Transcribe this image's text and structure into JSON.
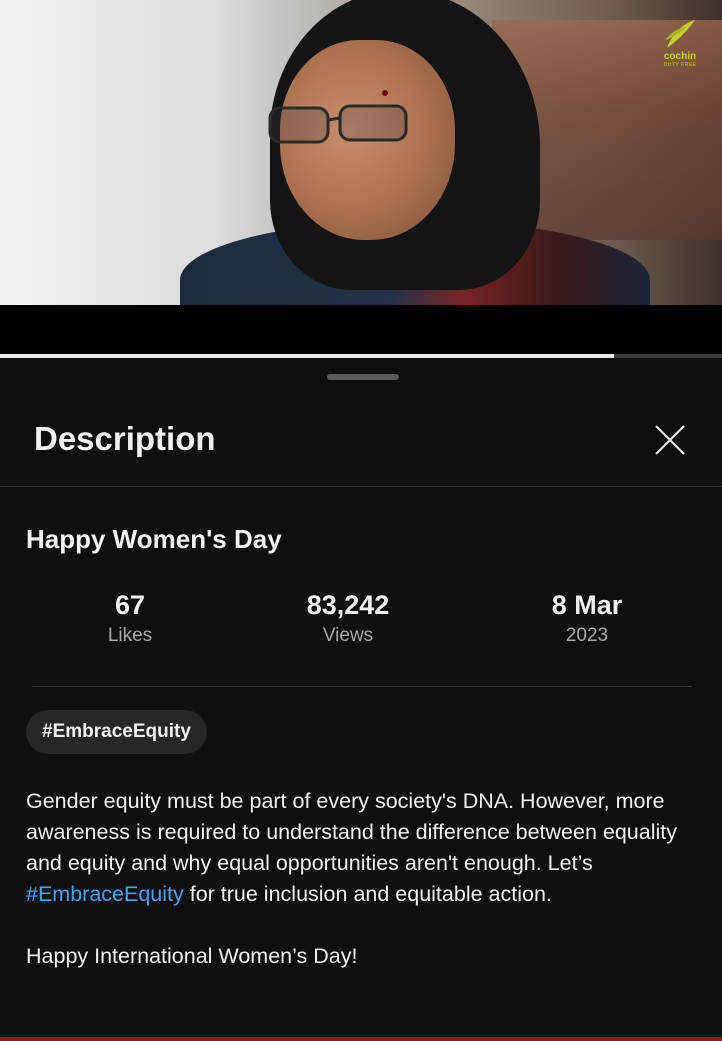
{
  "video": {
    "logo_name": "cochin",
    "logo_sub": "DUTY FREE",
    "progress_fraction": 0.85
  },
  "sheet": {
    "title": "Description",
    "close_icon": "close-icon"
  },
  "content": {
    "video_title": "Happy Women's Day",
    "stats": [
      {
        "value": "67",
        "label": "Likes"
      },
      {
        "value": "83,242",
        "label": "Views"
      },
      {
        "value": "8 Mar",
        "label": "2023"
      }
    ],
    "hashtag_chip": "#EmbraceEquity",
    "description": {
      "part1": "Gender equity must be part of every society's DNA. However, more awareness is required to understand the difference between equality and equity and why equal opportunities aren't enough. Let’s ",
      "link": "#EmbraceEquity",
      "part2": " for true inclusion and equitable action.",
      "closing": "Happy International Women’s Day!"
    }
  },
  "colors": {
    "background": "#0f0f0f",
    "link": "#3ea6ff",
    "chip": "#272727",
    "logo": "#c6d12a"
  }
}
